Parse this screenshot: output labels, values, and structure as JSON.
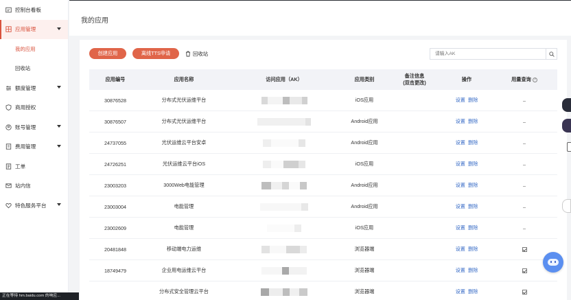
{
  "sidebar": {
    "items": [
      {
        "label": "控制台看板",
        "icon": "dashboard-icon",
        "chev": false,
        "active": false
      },
      {
        "label": "应用管理",
        "icon": "app-grid-icon",
        "chev": true,
        "active": true
      },
      {
        "label": "我的应用",
        "sub": true,
        "current": true
      },
      {
        "label": "回收站",
        "sub": true,
        "current": false
      },
      {
        "label": "额度管理",
        "icon": "sliders-icon",
        "chev": true,
        "active": false
      },
      {
        "label": "商用授权",
        "icon": "shield-icon",
        "chev": false,
        "active": false
      },
      {
        "label": "账号管理",
        "icon": "user-icon",
        "chev": true,
        "active": false
      },
      {
        "label": "费用管理",
        "icon": "bill-icon",
        "chev": true,
        "active": false
      },
      {
        "label": "工单",
        "icon": "ticket-icon",
        "chev": false,
        "active": false
      },
      {
        "label": "站内信",
        "icon": "mail-icon",
        "chev": false,
        "active": false
      },
      {
        "label": "特色服务平台",
        "icon": "heart-icon",
        "chev": true,
        "active": false
      }
    ]
  },
  "header": {
    "title": "我的应用"
  },
  "toolbar": {
    "create_label": "创建应用",
    "tts_label": "离线TTS申请",
    "recycle_label": "回收站",
    "search_placeholder": "请输入AK"
  },
  "table": {
    "headers": [
      "应用编号",
      "应用名称",
      "访问应用（AK）",
      "应用类别",
      "备注信息\n(双击更改)",
      "操作",
      "用量查询"
    ],
    "op_set": "设置",
    "op_delete": "删除",
    "rows": [
      {
        "id": "30876528",
        "name": "分布式光伏运维平台",
        "type": "iOS应用",
        "usage": "–"
      },
      {
        "id": "30876507",
        "name": "分布式光伏运维平台",
        "type": "Android应用",
        "usage": "–"
      },
      {
        "id": "24737055",
        "name": "光伏运维云平台安卓",
        "type": "Android应用",
        "usage": "–"
      },
      {
        "id": "24726251",
        "name": "光伏运维云平台iOS",
        "type": "iOS应用",
        "usage": "–"
      },
      {
        "id": "23003203",
        "name": "3000Web电能管理",
        "type": "Android应用",
        "usage": "–"
      },
      {
        "id": "23003004",
        "name": "电能管理",
        "type": "Android应用",
        "usage": "–"
      },
      {
        "id": "23002609",
        "name": "电能管理",
        "type": "iOS应用",
        "usage": "–"
      },
      {
        "id": "20481848",
        "name": "移动端电力运维",
        "type": "浏览器端",
        "usage": "check"
      },
      {
        "id": "18749479",
        "name": "企业用电运维云平台",
        "type": "浏览器端",
        "usage": "check"
      },
      {
        "id": "",
        "name": "分布式安全管理云平台",
        "type": "浏览器端",
        "usage": "check"
      }
    ]
  },
  "statusbar": {
    "text": "正在等待 hm.baidu.com 的响应..."
  },
  "colors": {
    "accent": "#e06549",
    "link": "#3b6ec7",
    "active_bg": "#fdf0ee"
  }
}
